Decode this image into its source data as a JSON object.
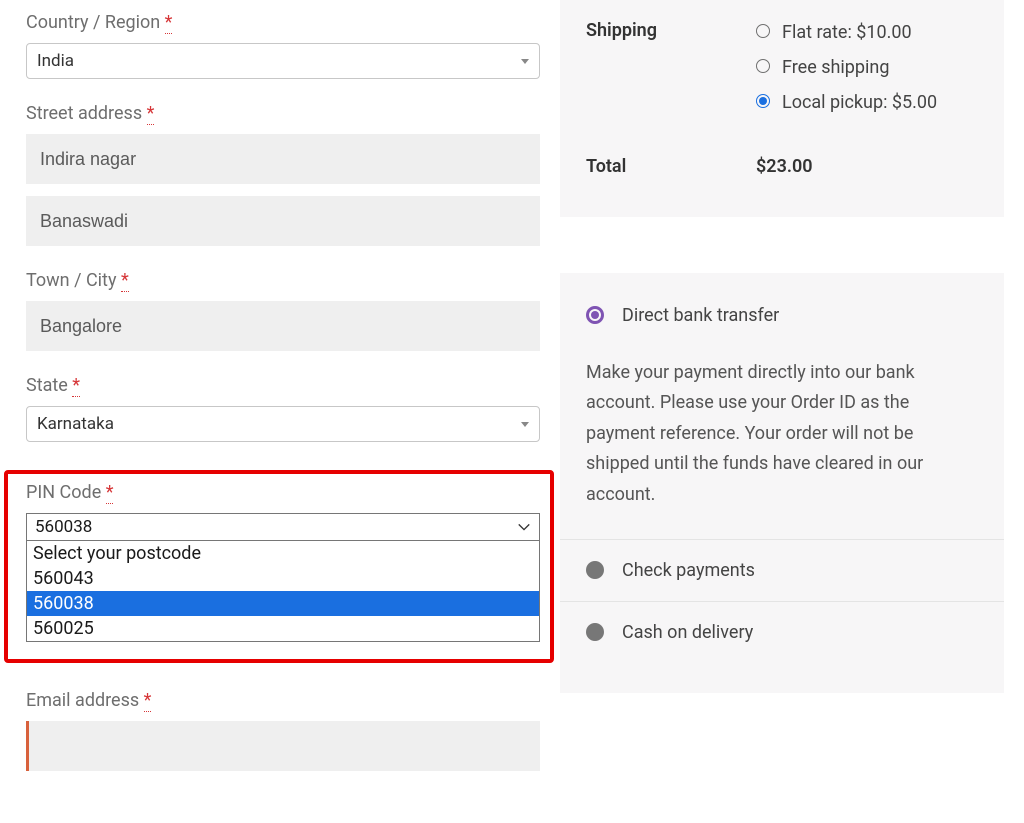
{
  "form": {
    "country": {
      "label": "Country / Region",
      "value": "India"
    },
    "street": {
      "label": "Street address",
      "line1": "Indira nagar",
      "line2": "Banaswadi"
    },
    "city": {
      "label": "Town / City",
      "value": "Bangalore"
    },
    "state": {
      "label": "State",
      "value": "Karnataka"
    },
    "pin": {
      "label": "PIN Code",
      "value": "560038",
      "options": [
        "Select your postcode",
        "560043",
        "560038",
        "560025"
      ],
      "highlighted": "560038"
    },
    "email": {
      "label": "Email address",
      "value": ""
    },
    "required_marker": "*"
  },
  "totals": {
    "shipping_label": "Shipping",
    "shipping_options": [
      {
        "label": "Flat rate: $10.00",
        "selected": false
      },
      {
        "label": "Free shipping",
        "selected": false
      },
      {
        "label": "Local pickup: $5.00",
        "selected": true
      }
    ],
    "total_label": "Total",
    "total_value": "$23.00"
  },
  "payment": {
    "methods": [
      {
        "label": "Direct bank transfer",
        "selected": true,
        "description": "Make your payment directly into our bank account. Please use your Order ID as the payment reference. Your order will not be shipped until the funds have cleared in our account."
      },
      {
        "label": "Check payments",
        "selected": false
      },
      {
        "label": "Cash on delivery",
        "selected": false
      }
    ]
  }
}
